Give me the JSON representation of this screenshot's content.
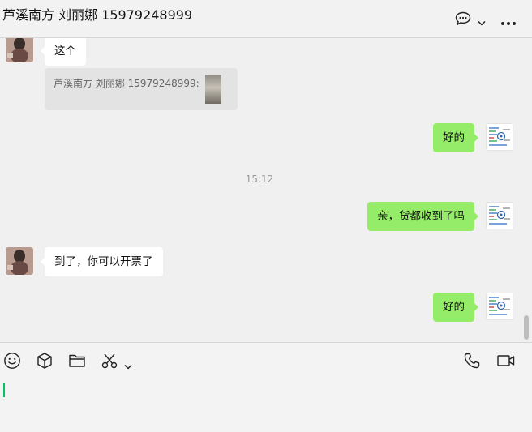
{
  "header": {
    "title": "芦溪南方 刘丽娜 15979248999",
    "icons": [
      "chat-bubble-icon",
      "chevron-down-icon",
      "more-icon"
    ]
  },
  "messages": [
    {
      "direction": "in",
      "text": "这个"
    },
    {
      "direction": "in",
      "type": "quote",
      "text": "芦溪南方 刘丽娜 15979248999:"
    },
    {
      "direction": "out",
      "text": "好的"
    },
    {
      "type": "time",
      "text": "15:12"
    },
    {
      "direction": "out",
      "text": "亲，货都收到了吗"
    },
    {
      "direction": "in",
      "text": "到了，你可以开票了"
    },
    {
      "direction": "out",
      "text": "好的"
    }
  ],
  "toolbar": {
    "icons": [
      "emoji-icon",
      "box-icon",
      "folder-icon",
      "scissors-icon",
      "chevron-down-icon",
      "phone-icon",
      "video-icon"
    ]
  },
  "colors": {
    "outgoing_bubble": "#95ec69",
    "incoming_bubble": "#ffffff",
    "background": "#f0f0f0",
    "cursor": "#07c160"
  }
}
